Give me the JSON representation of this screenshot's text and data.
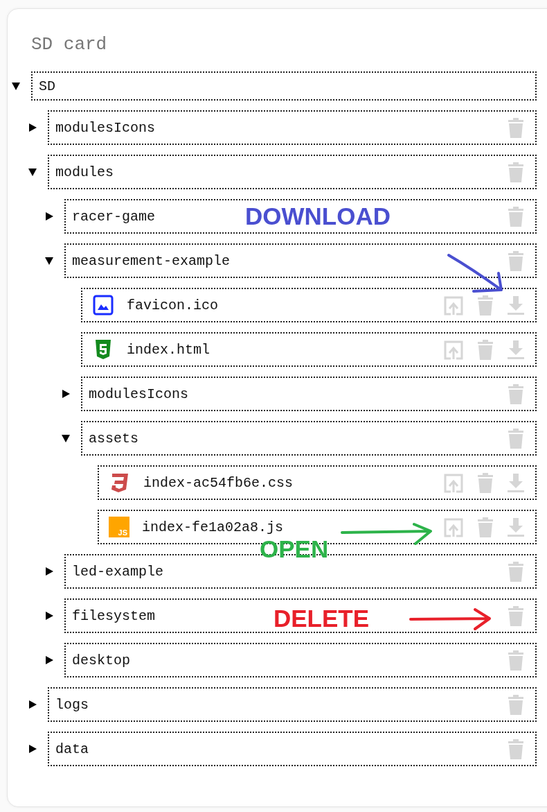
{
  "title": "SD card",
  "tree": {
    "name": "SD",
    "kind": "folder",
    "expanded": true,
    "children": [
      {
        "name": "modulesIcons",
        "kind": "folder",
        "expanded": false
      },
      {
        "name": "modules",
        "kind": "folder",
        "expanded": true,
        "children": [
          {
            "name": "racer-game",
            "kind": "folder",
            "expanded": false,
            "annotation": {
              "kind": "download",
              "text": "DOWNLOAD",
              "color": "#4a4fd0"
            }
          },
          {
            "name": "measurement-example",
            "kind": "folder",
            "expanded": true,
            "children": [
              {
                "name": "favicon.ico",
                "kind": "picture-file"
              },
              {
                "name": "index.html",
                "kind": "markup-file"
              },
              {
                "name": "modulesIcons",
                "kind": "folder",
                "expanded": false
              },
              {
                "name": "assets",
                "kind": "folder",
                "expanded": true,
                "children": [
                  {
                    "name": "index-ac54fb6e.css",
                    "kind": "style-file"
                  },
                  {
                    "name": "index-fe1a02a8.js",
                    "kind": "script-file",
                    "icon_text": "JS",
                    "annotation": {
                      "kind": "open",
                      "text": "OPEN",
                      "color": "#2db34a"
                    }
                  }
                ]
              }
            ]
          },
          {
            "name": "led-example",
            "kind": "folder",
            "expanded": false
          },
          {
            "name": "filesystem",
            "kind": "folder",
            "expanded": false,
            "annotation": {
              "kind": "delete",
              "text": "DELETE",
              "color": "#e8202a"
            }
          },
          {
            "name": "desktop",
            "kind": "folder",
            "expanded": false
          }
        ]
      },
      {
        "name": "logs",
        "kind": "folder",
        "expanded": false
      },
      {
        "name": "data",
        "kind": "folder",
        "expanded": false
      }
    ]
  }
}
